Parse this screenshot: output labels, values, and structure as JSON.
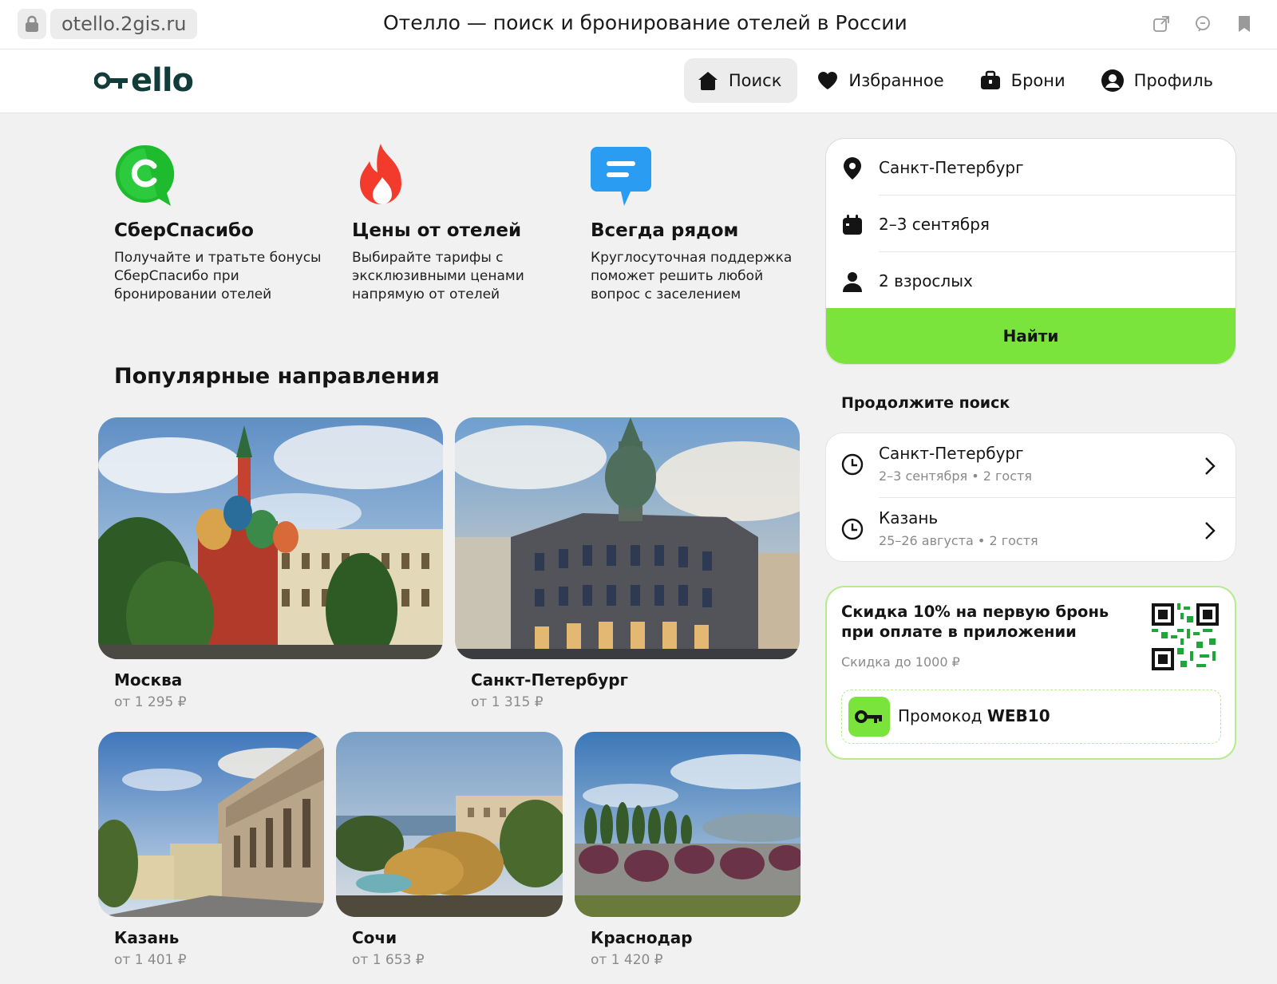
{
  "browser": {
    "url": "otello.2gis.ru",
    "title": "Отелло — поиск и бронирование отелей в России"
  },
  "header": {
    "logo": "ello",
    "nav": [
      {
        "label": "Поиск",
        "icon": "home-icon",
        "active": true
      },
      {
        "label": "Избранное",
        "icon": "heart-icon",
        "active": false
      },
      {
        "label": "Брони",
        "icon": "suitcase-icon",
        "active": false
      },
      {
        "label": "Профиль",
        "icon": "profile-icon",
        "active": false
      }
    ]
  },
  "features": [
    {
      "title": "СберСпасибо",
      "text": "Получайте и тратьте бонусы СберСпасибо при бронировании отелей",
      "icon": "sberspasibo-icon"
    },
    {
      "title": "Цены от отелей",
      "text": "Выбирайте тарифы с эксклюзивными ценами напрямую от отелей",
      "icon": "flame-icon"
    },
    {
      "title": "Всегда рядом",
      "text": "Круглосуточная поддержка поможет решить любой вопрос с заселением",
      "icon": "chat-bubble-icon"
    }
  ],
  "popular": {
    "title": "Популярные направления",
    "items": [
      {
        "name": "Москва",
        "price": "от 1 295 ₽"
      },
      {
        "name": "Санкт-Петербург",
        "price": "от 1 315 ₽"
      },
      {
        "name": "Казань",
        "price": "от 1 401 ₽"
      },
      {
        "name": "Сочи",
        "price": "от 1 653 ₽"
      },
      {
        "name": "Краснодар",
        "price": "от 1 420 ₽"
      }
    ]
  },
  "search": {
    "city": "Санкт-Петербург",
    "dates": "2–3 сентября",
    "guests": "2 взрослых",
    "button": "Найти"
  },
  "continue": {
    "title": "Продолжите поиск",
    "items": [
      {
        "city": "Санкт-Петербург",
        "dates": "2–3 сентября",
        "guests": "2 гостя"
      },
      {
        "city": "Казань",
        "dates": "25–26 августа",
        "guests": "2 гостя"
      }
    ]
  },
  "promo": {
    "title": "Скидка 10% на первую бронь при оплате в приложении",
    "subtitle": "Скидка до 1000 ₽",
    "code_label": "Промокод",
    "code": "WEB10"
  },
  "colors": {
    "accent": "#7be43c",
    "brand": "#123c3a",
    "background": "#f1f1f1"
  }
}
